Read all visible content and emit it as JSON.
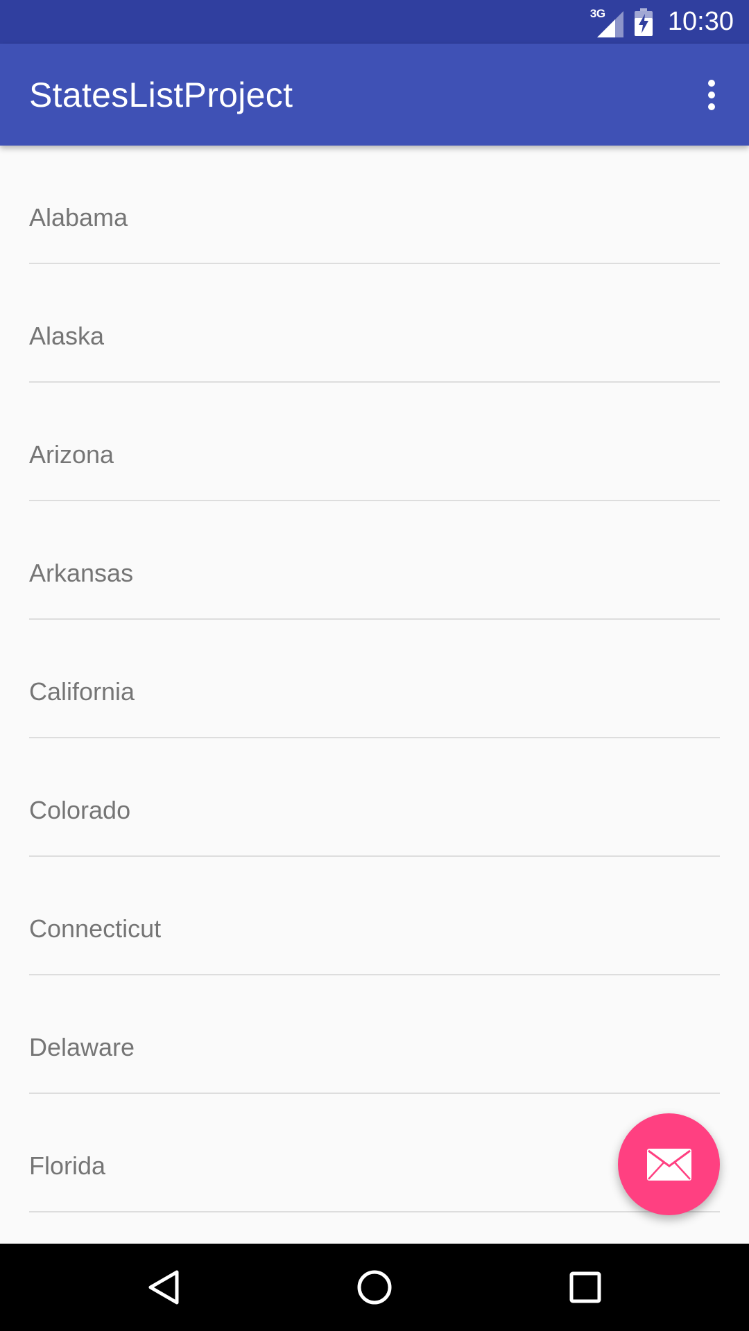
{
  "status_bar": {
    "network_label": "3G",
    "time": "10:30",
    "icons": [
      "signal-icon",
      "battery-charging-icon"
    ]
  },
  "app_bar": {
    "title": "StatesListProject",
    "overflow_icon": "more-vert-icon"
  },
  "list": {
    "items": [
      {
        "label": "Alabama"
      },
      {
        "label": "Alaska"
      },
      {
        "label": "Arizona"
      },
      {
        "label": "Arkansas"
      },
      {
        "label": "California"
      },
      {
        "label": "Colorado"
      },
      {
        "label": "Connecticut"
      },
      {
        "label": "Delaware"
      },
      {
        "label": "Florida"
      }
    ]
  },
  "fab": {
    "icon": "email-icon",
    "color": "#ff4081"
  },
  "nav_bar": {
    "buttons": [
      "back-icon",
      "home-icon",
      "recents-icon"
    ]
  },
  "colors": {
    "primary": "#3f51b5",
    "primary_dark": "#303f9f",
    "accent": "#ff4081",
    "background": "#fafafa",
    "text_secondary": "#757575",
    "divider": "#dddddd"
  }
}
